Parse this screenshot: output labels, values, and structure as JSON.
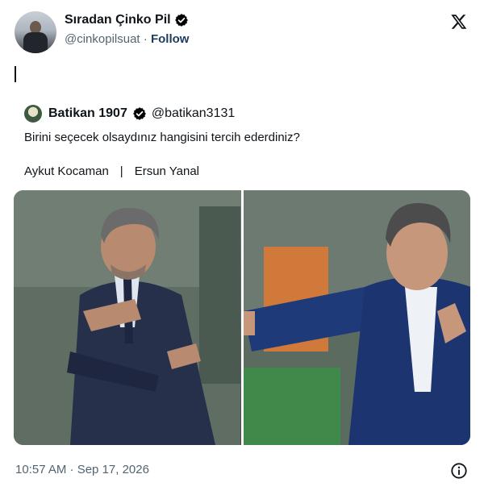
{
  "author": {
    "display_name": "Sıradan Çinko Pil",
    "handle": "@cinkopilsuat",
    "separator": "·",
    "follow_label": "Follow"
  },
  "quoted": {
    "display_name": "Batikan 1907",
    "handle": "@batikan3131",
    "text": "Birini seçecek olsaydınız hangisini tercih ederdiniz?",
    "option_a": "Aykut Kocaman",
    "divider": "|",
    "option_b": "Ersun Yanal"
  },
  "timestamp": "10:57 AM · Sep 17, 2026",
  "icons": {
    "verified": "verified-badge-icon",
    "logo": "x-logo-icon",
    "info": "info-icon"
  },
  "colors": {
    "verified_badge": "#000000",
    "secondary_text": "#536471",
    "follow": "#1d3d5c"
  }
}
